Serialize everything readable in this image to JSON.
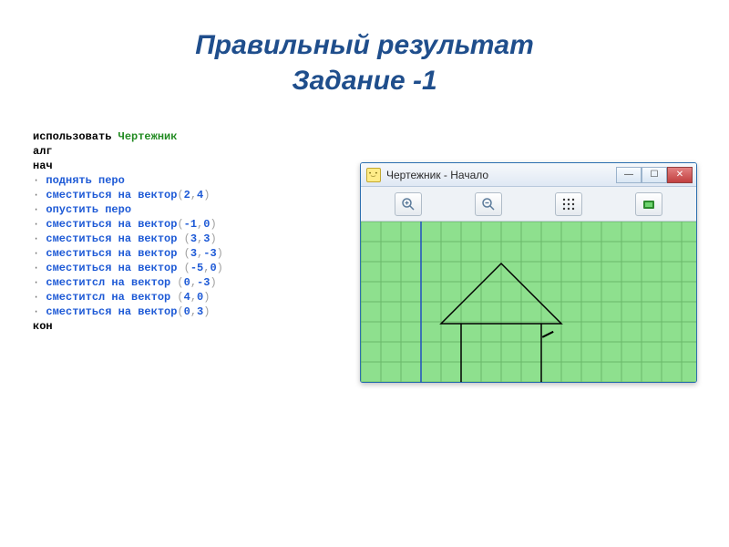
{
  "title": {
    "line1": "Правильный результат",
    "line2": "Задание -1"
  },
  "code": {
    "keyword_use": "использовать",
    "module": "Чертежник",
    "alg": "алг",
    "begin": "нач",
    "end": "кон",
    "lines": [
      {
        "cmd": "поднять перо",
        "args": null
      },
      {
        "cmd": "сместиться на вектор",
        "args": [
          "2",
          "4"
        ]
      },
      {
        "cmd": "опустить перо",
        "args": null
      },
      {
        "cmd": "сместиться на вектор",
        "args": [
          "-1",
          "0"
        ]
      },
      {
        "cmd": "сместиться на вектор",
        "args_spaced": true,
        "args": [
          "3",
          "3"
        ]
      },
      {
        "cmd": "сместиться на вектор",
        "args_spaced": true,
        "args": [
          "3",
          "-3"
        ]
      },
      {
        "cmd": "сместиться на вектор",
        "args_spaced": true,
        "args": [
          "-5",
          "0"
        ]
      },
      {
        "cmd": "сместитсл на вектор",
        "args_spaced": true,
        "args": [
          "0",
          "-3"
        ]
      },
      {
        "cmd": "сместитсл на вектор",
        "args_spaced": true,
        "args": [
          "4",
          "0"
        ]
      },
      {
        "cmd": "сместиться на вектор",
        "args": [
          "0",
          "3"
        ]
      }
    ]
  },
  "window": {
    "title": "Чертежник - Начало",
    "buttons": {
      "minimize": "—",
      "maximize": "☐",
      "close": "✕"
    },
    "toolbar": {
      "zoom_in": "zoom-in",
      "zoom_out": "zoom-out",
      "grid": "grid",
      "run": "run"
    }
  }
}
